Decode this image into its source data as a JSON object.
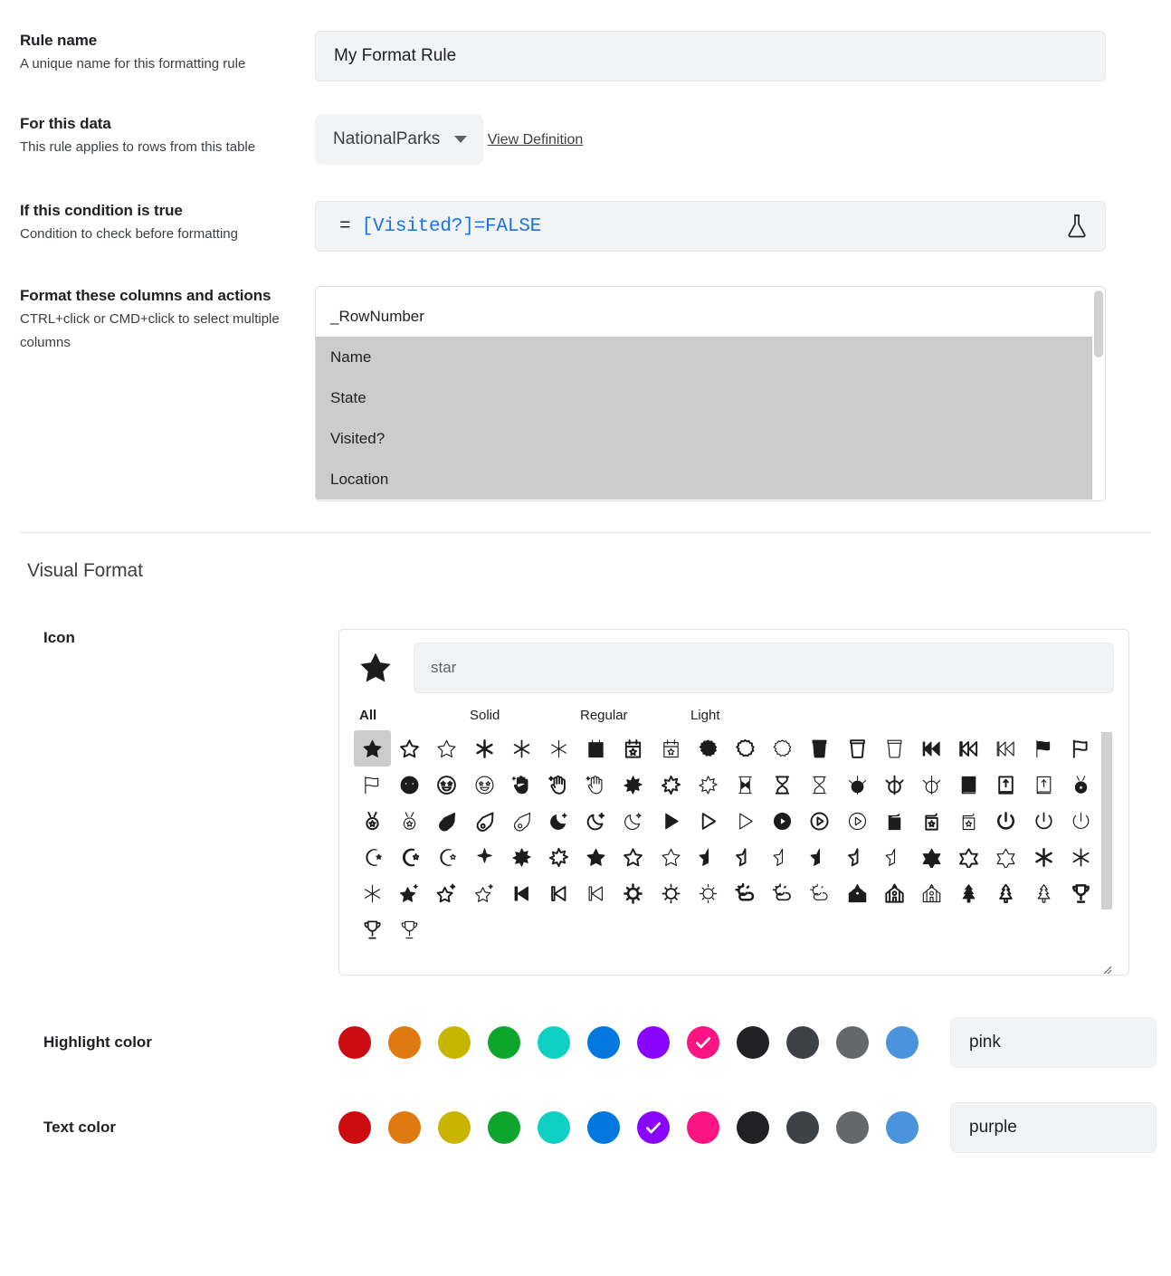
{
  "fields": {
    "rule_name": {
      "title": "Rule name",
      "desc": "A unique name for this formatting rule",
      "value": "My Format Rule"
    },
    "for_this_data": {
      "title": "For this data",
      "desc": "This rule applies to rows from this table",
      "selected": "NationalParks",
      "link": "View Definition"
    },
    "condition": {
      "title": "If this condition is true",
      "desc": "Condition to check before formatting",
      "equals": "=",
      "expression": "[Visited?]=FALSE",
      "flask_icon": "flask-icon"
    },
    "columns": {
      "title": "Format these columns and actions",
      "desc": "CTRL+click or CMD+click to select multiple columns",
      "options": [
        {
          "label": "_RowNumber",
          "selected": false
        },
        {
          "label": "Name",
          "selected": true
        },
        {
          "label": "State",
          "selected": true
        },
        {
          "label": "Visited?",
          "selected": true
        },
        {
          "label": "Location",
          "selected": true
        }
      ]
    }
  },
  "visual_format": {
    "section_title": "Visual Format",
    "icon": {
      "label": "Icon",
      "preview_icon": "star-solid-icon",
      "search_value": "star",
      "tabs": [
        {
          "label": "All",
          "active": true
        },
        {
          "label": "Solid",
          "active": false
        },
        {
          "label": "Regular",
          "active": false
        },
        {
          "label": "Light",
          "active": false
        }
      ],
      "grid": [
        {
          "n": "star-solid-icon",
          "s": "star",
          "f": "solid",
          "sel": true
        },
        {
          "n": "star-regular-icon",
          "s": "star",
          "f": "regular",
          "sel": false
        },
        {
          "n": "star-light-icon",
          "s": "star",
          "f": "light",
          "sel": false
        },
        {
          "n": "asterisk-solid-icon",
          "s": "asterisk",
          "f": "solid",
          "sel": false
        },
        {
          "n": "asterisk-regular-icon",
          "s": "asterisk",
          "f": "regular",
          "sel": false
        },
        {
          "n": "asterisk-light-icon",
          "s": "asterisk",
          "f": "light",
          "sel": false
        },
        {
          "n": "calendar-star-solid-icon",
          "s": "calendar-star",
          "f": "solid",
          "sel": false
        },
        {
          "n": "calendar-star-regular-icon",
          "s": "calendar-star",
          "f": "regular",
          "sel": false
        },
        {
          "n": "calendar-star-light-icon",
          "s": "calendar-star",
          "f": "light",
          "sel": false
        },
        {
          "n": "certificate-solid-icon",
          "s": "certificate",
          "f": "solid",
          "sel": false
        },
        {
          "n": "certificate-regular-icon",
          "s": "certificate",
          "f": "regular",
          "sel": false
        },
        {
          "n": "certificate-light-icon",
          "s": "certificate",
          "f": "light",
          "sel": false
        },
        {
          "n": "cup-solid-icon",
          "s": "cup",
          "f": "solid",
          "sel": false
        },
        {
          "n": "cup-regular-icon",
          "s": "cup",
          "f": "regular",
          "sel": false
        },
        {
          "n": "cup-light-icon",
          "s": "cup",
          "f": "light",
          "sel": false
        },
        {
          "n": "backward-fast-solid-icon",
          "s": "backward-fast",
          "f": "solid",
          "sel": false
        },
        {
          "n": "backward-fast-regular-icon",
          "s": "backward-fast",
          "f": "regular",
          "sel": false
        },
        {
          "n": "backward-fast-light-icon",
          "s": "backward-fast",
          "f": "light",
          "sel": false
        },
        {
          "n": "flag-usa-solid-icon",
          "s": "flag-usa",
          "f": "solid",
          "sel": false
        },
        {
          "n": "flag-usa-regular-icon",
          "s": "flag-usa",
          "f": "regular",
          "sel": false
        },
        {
          "n": "flag-usa-light-icon",
          "s": "flag-usa",
          "f": "light",
          "sel": false
        },
        {
          "n": "face-star-solid-icon",
          "s": "face-grin-stars",
          "f": "solid",
          "sel": false
        },
        {
          "n": "face-star-regular-icon",
          "s": "face-grin-stars",
          "f": "regular",
          "sel": false
        },
        {
          "n": "face-star-light-icon",
          "s": "face-grin-stars",
          "f": "light",
          "sel": false
        },
        {
          "n": "hand-sparkles-solid-icon",
          "s": "hand-sparkles",
          "f": "solid",
          "sel": false
        },
        {
          "n": "hand-sparkles-regular-icon",
          "s": "hand-sparkles",
          "f": "regular",
          "sel": false
        },
        {
          "n": "hand-sparkles-light-icon",
          "s": "hand-sparkles",
          "f": "light",
          "sel": false
        },
        {
          "n": "sparkle-burst-solid-icon",
          "s": "burst",
          "f": "solid",
          "sel": false
        },
        {
          "n": "sparkle-burst-regular-icon",
          "s": "burst",
          "f": "regular",
          "sel": false
        },
        {
          "n": "sparkle-burst-light-icon",
          "s": "burst",
          "f": "light",
          "sel": false
        },
        {
          "n": "hourglass-solid-icon",
          "s": "hourglass",
          "f": "solid",
          "sel": false
        },
        {
          "n": "hourglass-regular-icon",
          "s": "hourglass",
          "f": "regular",
          "sel": false
        },
        {
          "n": "hourglass-light-icon",
          "s": "hourglass",
          "f": "light",
          "sel": false
        },
        {
          "n": "jedi-solid-icon",
          "s": "jedi",
          "f": "solid",
          "sel": false
        },
        {
          "n": "jedi-regular-icon",
          "s": "jedi",
          "f": "regular",
          "sel": false
        },
        {
          "n": "jedi-light-icon",
          "s": "jedi",
          "f": "light",
          "sel": false
        },
        {
          "n": "book-jedi-solid-icon",
          "s": "book-jedi",
          "f": "solid",
          "sel": false
        },
        {
          "n": "book-jedi-regular-icon",
          "s": "book-jedi",
          "f": "regular",
          "sel": false
        },
        {
          "n": "book-jedi-light-icon",
          "s": "book-jedi",
          "f": "light",
          "sel": false
        },
        {
          "n": "medal-solid-icon",
          "s": "medal",
          "f": "solid",
          "sel": false
        },
        {
          "n": "medal-regular-icon",
          "s": "medal",
          "f": "regular",
          "sel": false
        },
        {
          "n": "medal-light-icon",
          "s": "medal",
          "f": "light",
          "sel": false
        },
        {
          "n": "meteor-solid-icon",
          "s": "meteor",
          "f": "solid",
          "sel": false
        },
        {
          "n": "meteor-regular-icon",
          "s": "meteor",
          "f": "regular",
          "sel": false
        },
        {
          "n": "meteor-light-icon",
          "s": "meteor",
          "f": "light",
          "sel": false
        },
        {
          "n": "moon-stars-solid-icon",
          "s": "moon-stars",
          "f": "solid",
          "sel": false
        },
        {
          "n": "moon-stars-regular-icon",
          "s": "moon-stars",
          "f": "regular",
          "sel": false
        },
        {
          "n": "moon-stars-light-icon",
          "s": "moon-stars",
          "f": "light",
          "sel": false
        },
        {
          "n": "play-solid-icon",
          "s": "play",
          "f": "solid",
          "sel": false
        },
        {
          "n": "play-regular-icon",
          "s": "play",
          "f": "regular",
          "sel": false
        },
        {
          "n": "play-light-icon",
          "s": "play",
          "f": "light",
          "sel": false
        },
        {
          "n": "circle-play-solid-icon",
          "s": "circle-play",
          "f": "solid",
          "sel": false
        },
        {
          "n": "circle-play-regular-icon",
          "s": "circle-play",
          "f": "regular",
          "sel": false
        },
        {
          "n": "circle-play-light-icon",
          "s": "circle-play",
          "f": "light",
          "sel": false
        },
        {
          "n": "podium-star-solid-icon",
          "s": "podium-star",
          "f": "solid",
          "sel": false
        },
        {
          "n": "podium-star-regular-icon",
          "s": "podium-star",
          "f": "regular",
          "sel": false
        },
        {
          "n": "podium-star-light-icon",
          "s": "podium-star",
          "f": "light",
          "sel": false
        },
        {
          "n": "power-off-solid-icon",
          "s": "power-off",
          "f": "solid",
          "sel": false
        },
        {
          "n": "power-off-regular-icon",
          "s": "power-off",
          "f": "regular",
          "sel": false
        },
        {
          "n": "power-off-light-icon",
          "s": "power-off",
          "f": "light",
          "sel": false
        },
        {
          "n": "star-and-crescent-solid-icon",
          "s": "star-and-crescent",
          "f": "solid",
          "sel": false
        },
        {
          "n": "star-and-crescent-regular-icon",
          "s": "star-and-crescent",
          "f": "regular",
          "sel": false
        },
        {
          "n": "star-and-crescent-light-icon",
          "s": "star-and-crescent",
          "f": "light",
          "sel": false
        },
        {
          "n": "sparkle-solid-icon",
          "s": "sparkle",
          "f": "solid",
          "sel": false
        },
        {
          "n": "star-christmas-solid-icon",
          "s": "star-christmas",
          "f": "solid",
          "sel": false
        },
        {
          "n": "star-christmas-regular-icon",
          "s": "star-christmas",
          "f": "regular",
          "sel": false
        },
        {
          "n": "star-exclamation-solid-icon",
          "s": "star-exclamation",
          "f": "solid",
          "sel": false
        },
        {
          "n": "star-exclamation-regular-icon",
          "s": "star-exclamation",
          "f": "regular",
          "sel": false
        },
        {
          "n": "star-exclamation-light-icon",
          "s": "star-exclamation",
          "f": "light",
          "sel": false
        },
        {
          "n": "star-half-solid-icon",
          "s": "star-half",
          "f": "solid",
          "sel": false
        },
        {
          "n": "star-half-regular-icon",
          "s": "star-half",
          "f": "regular",
          "sel": false
        },
        {
          "n": "star-half-light-icon",
          "s": "star-half",
          "f": "light",
          "sel": false
        },
        {
          "n": "star-half-stroke-solid-icon",
          "s": "star-half-stroke",
          "f": "solid",
          "sel": false
        },
        {
          "n": "star-shooting-regular-icon",
          "s": "star-shooting",
          "f": "regular",
          "sel": false
        },
        {
          "n": "star-shooting-light-icon",
          "s": "star-shooting",
          "f": "light",
          "sel": false
        },
        {
          "n": "star-of-david-solid-icon",
          "s": "star-of-david",
          "f": "solid",
          "sel": false
        },
        {
          "n": "star-of-david-regular-icon",
          "s": "star-of-david",
          "f": "regular",
          "sel": false
        },
        {
          "n": "star-of-david-light-icon",
          "s": "star-of-david",
          "f": "light",
          "sel": false
        },
        {
          "n": "star-of-life-solid-icon",
          "s": "star-of-life",
          "f": "solid",
          "sel": false
        },
        {
          "n": "star-of-life-regular-icon",
          "s": "star-of-life",
          "f": "regular",
          "sel": false
        },
        {
          "n": "star-of-life-light-icon",
          "s": "star-of-life",
          "f": "light",
          "sel": false
        },
        {
          "n": "star-sparkle-solid-icon",
          "s": "star-sparkle",
          "f": "solid",
          "sel": false
        },
        {
          "n": "star-sparkle-regular-icon",
          "s": "star-sparkle",
          "f": "regular",
          "sel": false
        },
        {
          "n": "star-sparkle-light-icon",
          "s": "star-sparkle",
          "f": "light",
          "sel": false
        },
        {
          "n": "backward-step-solid-icon",
          "s": "backward-step",
          "f": "solid",
          "sel": false
        },
        {
          "n": "backward-step-regular-icon",
          "s": "backward-step",
          "f": "regular",
          "sel": false
        },
        {
          "n": "backward-step-light-icon",
          "s": "backward-step",
          "f": "light",
          "sel": false
        },
        {
          "n": "sun-bright-solid-icon",
          "s": "sun-bright",
          "f": "solid",
          "sel": false
        },
        {
          "n": "sun-bright-regular-icon",
          "s": "sun-bright",
          "f": "regular",
          "sel": false
        },
        {
          "n": "sun-bright-light-icon",
          "s": "sun-bright",
          "f": "light",
          "sel": false
        },
        {
          "n": "sun-cloud-solid-icon",
          "s": "sun-cloud",
          "f": "solid",
          "sel": false
        },
        {
          "n": "sun-cloud-regular-icon",
          "s": "sun-cloud",
          "f": "regular",
          "sel": false
        },
        {
          "n": "sun-cloud-light-icon",
          "s": "sun-cloud",
          "f": "light",
          "sel": false
        },
        {
          "n": "synagogue-solid-icon",
          "s": "synagogue",
          "f": "solid",
          "sel": false
        },
        {
          "n": "synagogue-regular-icon",
          "s": "synagogue",
          "f": "regular",
          "sel": false
        },
        {
          "n": "synagogue-light-icon",
          "s": "synagogue",
          "f": "light",
          "sel": false
        },
        {
          "n": "tree-christmas-solid-icon",
          "s": "tree-christmas",
          "f": "solid",
          "sel": false
        },
        {
          "n": "tree-christmas-regular-icon",
          "s": "tree-christmas",
          "f": "regular",
          "sel": false
        },
        {
          "n": "tree-christmas-light-icon",
          "s": "tree-christmas",
          "f": "light",
          "sel": false
        },
        {
          "n": "trophy-star-solid-icon",
          "s": "trophy-star",
          "f": "solid",
          "sel": false
        },
        {
          "n": "trophy-star-regular-icon",
          "s": "trophy-star",
          "f": "regular",
          "sel": false
        },
        {
          "n": "trophy-star-light-icon",
          "s": "trophy-star",
          "f": "light",
          "sel": false
        }
      ]
    },
    "highlight_color": {
      "label": "Highlight color",
      "value": "pink",
      "selected_index": 7,
      "swatches": [
        {
          "name": "red",
          "hex": "#CC0B11"
        },
        {
          "name": "orange",
          "hex": "#DE7A0F"
        },
        {
          "name": "yellow",
          "hex": "#C9B400"
        },
        {
          "name": "green",
          "hex": "#0DA52B"
        },
        {
          "name": "teal",
          "hex": "#0ED1C3"
        },
        {
          "name": "blue",
          "hex": "#0277E0"
        },
        {
          "name": "purple",
          "hex": "#8A05FF"
        },
        {
          "name": "pink",
          "hex": "#FC1482"
        },
        {
          "name": "black",
          "hex": "#212124"
        },
        {
          "name": "darkgray",
          "hex": "#3E4246"
        },
        {
          "name": "gray",
          "hex": "#65686B"
        },
        {
          "name": "lightblue",
          "hex": "#4A93DD"
        }
      ]
    },
    "text_color": {
      "label": "Text color",
      "value": "purple",
      "selected_index": 6,
      "swatches": [
        {
          "name": "red",
          "hex": "#CC0B11"
        },
        {
          "name": "orange",
          "hex": "#DE7A0F"
        },
        {
          "name": "yellow",
          "hex": "#C9B400"
        },
        {
          "name": "green",
          "hex": "#0DA52B"
        },
        {
          "name": "teal",
          "hex": "#0ED1C3"
        },
        {
          "name": "blue",
          "hex": "#0277E0"
        },
        {
          "name": "purple",
          "hex": "#8A05FF"
        },
        {
          "name": "pink",
          "hex": "#FC1482"
        },
        {
          "name": "black",
          "hex": "#212124"
        },
        {
          "name": "darkgray",
          "hex": "#3E4246"
        },
        {
          "name": "gray",
          "hex": "#65686B"
        },
        {
          "name": "lightblue",
          "hex": "#4A93DD"
        }
      ]
    }
  }
}
